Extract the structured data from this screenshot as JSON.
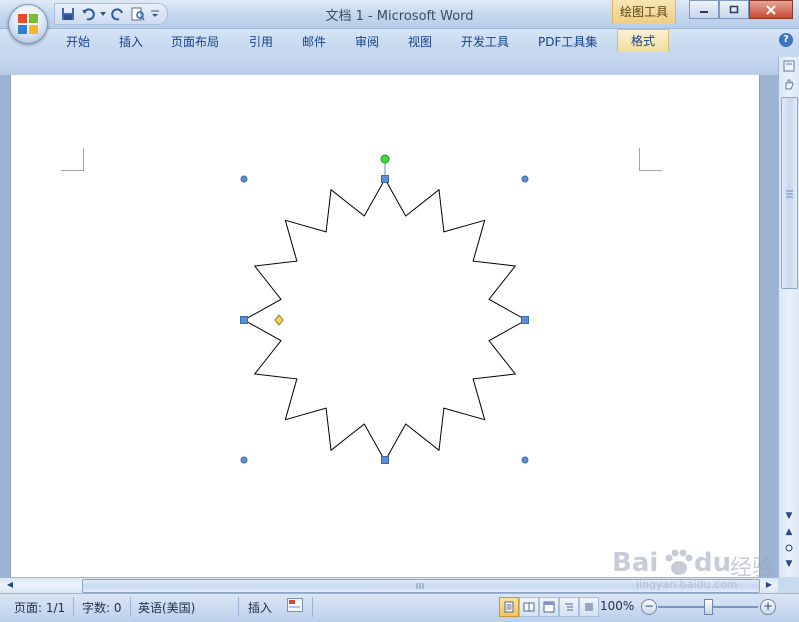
{
  "window": {
    "title": "文档 1 - Microsoft Word",
    "context_tab": "绘图工具"
  },
  "quick_access": {
    "icons": [
      "save-icon",
      "undo-icon",
      "redo-icon",
      "print-preview-icon",
      "customize-icon"
    ]
  },
  "ribbon": {
    "tabs": [
      "开始",
      "插入",
      "页面布局",
      "引用",
      "邮件",
      "审阅",
      "视图",
      "开发工具",
      "PDF工具集",
      "格式"
    ],
    "help": "?"
  },
  "status_bar": {
    "page": "页面: 1/1",
    "words": "字数: 0",
    "language": "英语(美国)",
    "mode": "插入",
    "zoom": "100%",
    "zoom_minus": "−",
    "zoom_plus": "+",
    "zoom_level_percent": 100
  },
  "shape": {
    "type": "star-16-point",
    "outline_color": "#000000",
    "handle_color": "#5b8fd1",
    "rotate_handle_color": "#3cdc3c",
    "adjust_handle_color": "#f7d54a"
  },
  "watermark": {
    "brand": "Bai",
    "brand2": "du",
    "product": "经验",
    "url": "jingyan.baidu.com"
  }
}
